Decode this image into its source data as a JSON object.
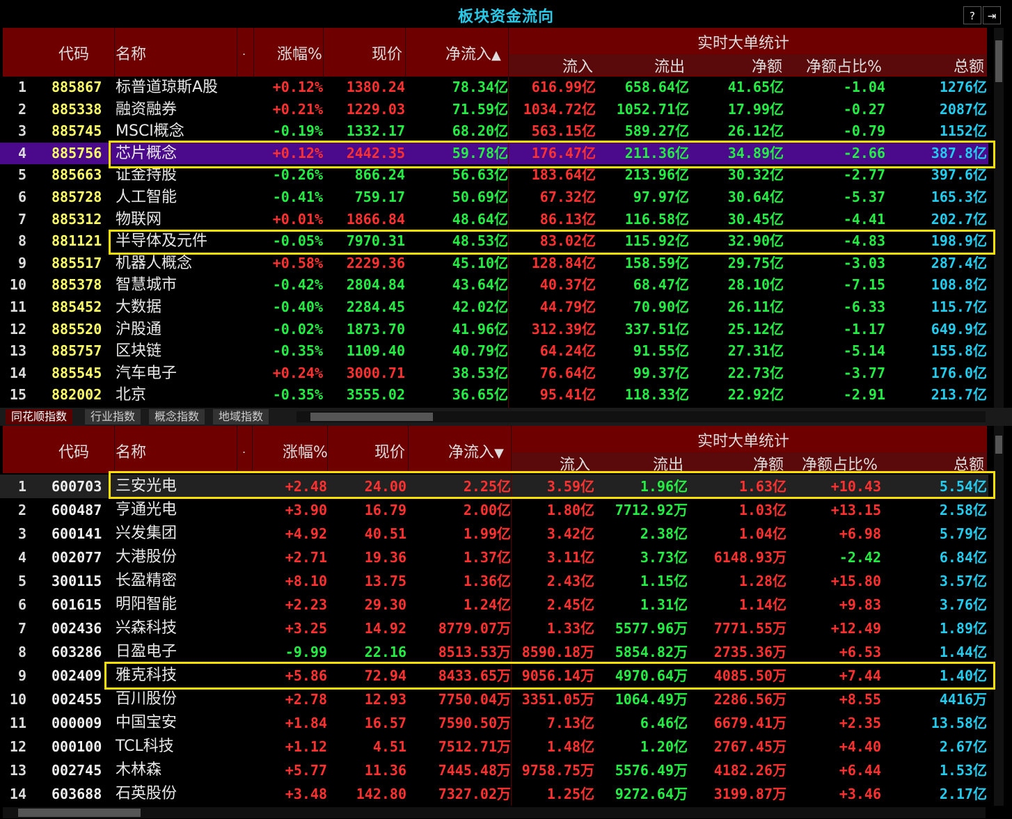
{
  "title": "板块资金流向",
  "help_label": "?",
  "exit_label": "⇥",
  "headers": {
    "code": "代码",
    "name": "名称",
    "dot": ".",
    "change": "涨幅%",
    "price": "现价",
    "netflow_up": "净流入",
    "netflow_down": "净流入",
    "big": "实时大单统计",
    "inflow": "流入",
    "outflow": "流出",
    "net": "净额",
    "netpct": "净额占比%",
    "total": "总额"
  },
  "tabs": [
    "同花顺指数",
    "行业指数",
    "概念指数",
    "地域指数"
  ],
  "top_rows": [
    {
      "idx": "1",
      "code": "885867",
      "name": "标普道琼斯A股",
      "chg": "+0.12%",
      "price": "1380.24",
      "net": "78.34亿",
      "in": "616.99亿",
      "out": "658.64亿",
      "big": "41.65亿",
      "pct": "-1.04",
      "total": "1276亿"
    },
    {
      "idx": "2",
      "code": "885338",
      "name": "融资融券",
      "chg": "+0.21%",
      "price": "1229.03",
      "net": "71.59亿",
      "in": "1034.72亿",
      "out": "1052.71亿",
      "big": "17.99亿",
      "pct": "-0.27",
      "total": "2087亿"
    },
    {
      "idx": "3",
      "code": "885745",
      "name": "MSCI概念",
      "chg": "-0.19%",
      "price": "1332.17",
      "net": "68.20亿",
      "in": "563.15亿",
      "out": "589.27亿",
      "big": "26.12亿",
      "pct": "-0.79",
      "total": "1152亿"
    },
    {
      "idx": "4",
      "code": "885756",
      "name": "芯片概念",
      "chg": "+0.12%",
      "price": "2442.35",
      "net": "59.78亿",
      "in": "176.47亿",
      "out": "211.36亿",
      "big": "34.89亿",
      "pct": "-2.66",
      "total": "387.8亿"
    },
    {
      "idx": "5",
      "code": "885663",
      "name": "证金持股",
      "chg": "-0.26%",
      "price": "866.24",
      "net": "56.63亿",
      "in": "183.64亿",
      "out": "213.96亿",
      "big": "30.32亿",
      "pct": "-2.77",
      "total": "397.6亿"
    },
    {
      "idx": "6",
      "code": "885728",
      "name": "人工智能",
      "chg": "-0.41%",
      "price": "759.17",
      "net": "50.69亿",
      "in": "67.32亿",
      "out": "97.97亿",
      "big": "30.64亿",
      "pct": "-5.37",
      "total": "165.3亿"
    },
    {
      "idx": "7",
      "code": "885312",
      "name": "物联网",
      "chg": "+0.01%",
      "price": "1866.84",
      "net": "48.64亿",
      "in": "86.13亿",
      "out": "116.58亿",
      "big": "30.45亿",
      "pct": "-4.41",
      "total": "202.7亿"
    },
    {
      "idx": "8",
      "code": "881121",
      "name": "半导体及元件",
      "chg": "-0.05%",
      "price": "7970.31",
      "net": "48.53亿",
      "in": "83.02亿",
      "out": "115.92亿",
      "big": "32.90亿",
      "pct": "-4.83",
      "total": "198.9亿"
    },
    {
      "idx": "9",
      "code": "885517",
      "name": "机器人概念",
      "chg": "+0.58%",
      "price": "2229.36",
      "net": "45.10亿",
      "in": "128.84亿",
      "out": "158.59亿",
      "big": "29.75亿",
      "pct": "-3.03",
      "total": "287.4亿"
    },
    {
      "idx": "10",
      "code": "885378",
      "name": "智慧城市",
      "chg": "-0.42%",
      "price": "2804.84",
      "net": "43.64亿",
      "in": "40.37亿",
      "out": "68.47亿",
      "big": "28.10亿",
      "pct": "-7.15",
      "total": "108.8亿"
    },
    {
      "idx": "11",
      "code": "885452",
      "name": "大数据",
      "chg": "-0.40%",
      "price": "2284.45",
      "net": "42.02亿",
      "in": "44.79亿",
      "out": "70.90亿",
      "big": "26.11亿",
      "pct": "-6.33",
      "total": "115.7亿"
    },
    {
      "idx": "12",
      "code": "885520",
      "name": "沪股通",
      "chg": "-0.02%",
      "price": "1873.70",
      "net": "41.96亿",
      "in": "312.39亿",
      "out": "337.51亿",
      "big": "25.12亿",
      "pct": "-1.17",
      "total": "649.9亿"
    },
    {
      "idx": "13",
      "code": "885757",
      "name": "区块链",
      "chg": "-0.35%",
      "price": "1109.40",
      "net": "40.79亿",
      "in": "64.24亿",
      "out": "91.55亿",
      "big": "27.31亿",
      "pct": "-5.14",
      "total": "155.8亿"
    },
    {
      "idx": "14",
      "code": "885545",
      "name": "汽车电子",
      "chg": "+0.24%",
      "price": "3000.71",
      "net": "38.53亿",
      "in": "76.64亿",
      "out": "99.37亿",
      "big": "22.73亿",
      "pct": "-3.77",
      "total": "176.0亿"
    },
    {
      "idx": "15",
      "code": "882002",
      "name": "北京",
      "chg": "-0.35%",
      "price": "3555.02",
      "net": "36.65亿",
      "in": "95.41亿",
      "out": "118.33亿",
      "big": "22.92亿",
      "pct": "-2.91",
      "total": "213.7亿"
    }
  ],
  "bottom_rows": [
    {
      "idx": "1",
      "code": "600703",
      "name": "三安光电",
      "chg": "+2.48",
      "price": "24.00",
      "net": "2.25亿",
      "in": "3.59亿",
      "out": "1.96亿",
      "big": "1.63亿",
      "pct": "+10.43",
      "total": "5.54亿"
    },
    {
      "idx": "2",
      "code": "600487",
      "name": "亨通光电",
      "chg": "+3.90",
      "price": "16.79",
      "net": "2.00亿",
      "in": "1.80亿",
      "out": "7712.92万",
      "big": "1.03亿",
      "pct": "+13.15",
      "total": "2.58亿"
    },
    {
      "idx": "3",
      "code": "600141",
      "name": "兴发集团",
      "chg": "+4.92",
      "price": "40.51",
      "net": "1.99亿",
      "in": "3.42亿",
      "out": "2.38亿",
      "big": "1.04亿",
      "pct": "+6.98",
      "total": "5.79亿"
    },
    {
      "idx": "4",
      "code": "002077",
      "name": "大港股份",
      "chg": "+2.71",
      "price": "19.36",
      "net": "1.37亿",
      "in": "3.11亿",
      "out": "3.73亿",
      "big": "6148.93万",
      "pct": "-2.42",
      "total": "6.84亿"
    },
    {
      "idx": "5",
      "code": "300115",
      "name": "长盈精密",
      "chg": "+8.10",
      "price": "13.75",
      "net": "1.36亿",
      "in": "2.43亿",
      "out": "1.15亿",
      "big": "1.28亿",
      "pct": "+15.80",
      "total": "3.57亿"
    },
    {
      "idx": "6",
      "code": "601615",
      "name": "明阳智能",
      "chg": "+2.23",
      "price": "29.30",
      "net": "1.24亿",
      "in": "2.45亿",
      "out": "1.31亿",
      "big": "1.14亿",
      "pct": "+9.83",
      "total": "3.76亿"
    },
    {
      "idx": "7",
      "code": "002436",
      "name": "兴森科技",
      "chg": "+3.25",
      "price": "14.92",
      "net": "8779.07万",
      "in": "1.33亿",
      "out": "5577.96万",
      "big": "7771.55万",
      "pct": "+12.49",
      "total": "1.89亿"
    },
    {
      "idx": "8",
      "code": "603286",
      "name": "日盈电子",
      "chg": "-9.99",
      "price": "22.16",
      "net": "8513.53万",
      "in": "8590.18万",
      "out": "5854.82万",
      "big": "2735.36万",
      "pct": "+6.53",
      "total": "1.44亿"
    },
    {
      "idx": "9",
      "code": "002409",
      "name": "雅克科技",
      "chg": "+5.86",
      "price": "72.94",
      "net": "8433.65万",
      "in": "9056.14万",
      "out": "4970.64万",
      "big": "4085.50万",
      "pct": "+7.44",
      "total": "1.40亿"
    },
    {
      "idx": "10",
      "code": "002455",
      "name": "百川股份",
      "chg": "+2.78",
      "price": "12.93",
      "net": "7750.04万",
      "in": "3351.05万",
      "out": "1064.49万",
      "big": "2286.56万",
      "pct": "+8.55",
      "total": "4416万"
    },
    {
      "idx": "11",
      "code": "000009",
      "name": "中国宝安",
      "chg": "+1.84",
      "price": "16.57",
      "net": "7590.50万",
      "in": "7.13亿",
      "out": "6.46亿",
      "big": "6679.41万",
      "pct": "+2.35",
      "total": "13.58亿"
    },
    {
      "idx": "12",
      "code": "000100",
      "name": "TCL科技",
      "chg": "+1.12",
      "price": "4.51",
      "net": "7512.71万",
      "in": "1.48亿",
      "out": "1.20亿",
      "big": "2767.45万",
      "pct": "+4.40",
      "total": "2.67亿"
    },
    {
      "idx": "13",
      "code": "002745",
      "name": "木林森",
      "chg": "+5.77",
      "price": "11.36",
      "net": "7445.48万",
      "in": "9758.75万",
      "out": "5576.49万",
      "big": "4182.26万",
      "pct": "+6.44",
      "total": "1.53亿"
    },
    {
      "idx": "14",
      "code": "603688",
      "name": "石英股份",
      "chg": "+3.48",
      "price": "142.80",
      "net": "7327.02万",
      "in": "1.25亿",
      "out": "9272.64万",
      "big": "3199.87万",
      "pct": "+3.46",
      "total": "2.17亿"
    }
  ],
  "colors": {
    "up": "#ff3030",
    "down": "#22ee44",
    "cyan": "#22ccee",
    "highlight": "#ffe000",
    "selected": "#4b0a8c",
    "header": "#6e0000"
  }
}
